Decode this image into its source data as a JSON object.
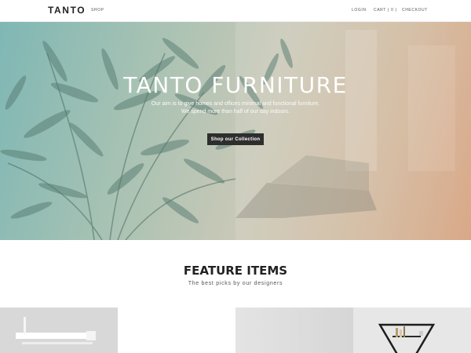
{
  "header": {
    "logo": "TANTO",
    "nav_left": [
      "SHOP"
    ],
    "nav_right": [
      "LOGIN",
      "CART ( 0 )",
      "CHECKOUT"
    ]
  },
  "hero": {
    "title": "TANTO FURNITURE",
    "text_line_1": "Our aim is to give homes and offices minimal and functional furniture.",
    "text_line_2": "We spend more than half of our day indoors.",
    "button_label": "Shop our Collection"
  },
  "feature": {
    "title": "FEATURE ITEMS",
    "subtitle": "The best picks by our designers",
    "items": [
      {
        "image": "white-shelf-product-image"
      },
      {
        "image": "blank-product-image"
      },
      {
        "image": "grey-product-image"
      },
      {
        "image": "triangle-shelf-product-image"
      }
    ]
  },
  "colors": {
    "hero_gradient_left": "#7fb7b5",
    "hero_gradient_right": "#d49d78",
    "button_bg": "#2e2e2e",
    "text_dark": "#222222"
  }
}
